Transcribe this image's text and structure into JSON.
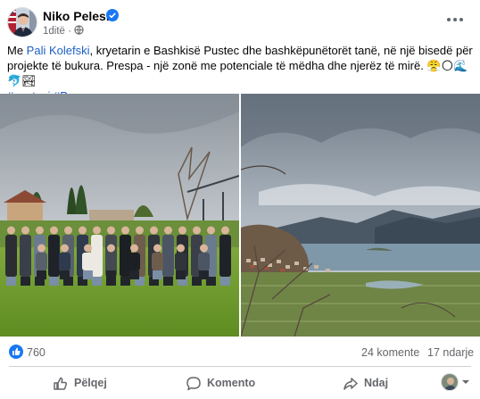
{
  "post": {
    "author": "Niko Peleshi",
    "time": "1ditë",
    "caption_before": "Me ",
    "mention": "Pali Kolefski",
    "caption_after": ", kryetarin e Bashkisë Pustec dhe bashkëpunëtorët tanë, në një bisedë për projekte të bukura. Prespa - një zonë me potenciale të mëdha dhe njerëz të mirë. 😤🌕🌊🐬🏞",
    "hashtags": "#pusteci #Prespa",
    "icons": {
      "verified": "verified-badge-icon",
      "audience": "globe-icon",
      "more": "more-options-icon"
    }
  },
  "stats": {
    "reactions": "760",
    "comments": "24 komente",
    "shares": "17 ndarje"
  },
  "actions": {
    "like": "Pëlqej",
    "comment": "Komento",
    "share": "Ndaj"
  },
  "colors": {
    "brand": "#1877f2",
    "link": "#1d5fc2",
    "muted": "#65676b"
  }
}
